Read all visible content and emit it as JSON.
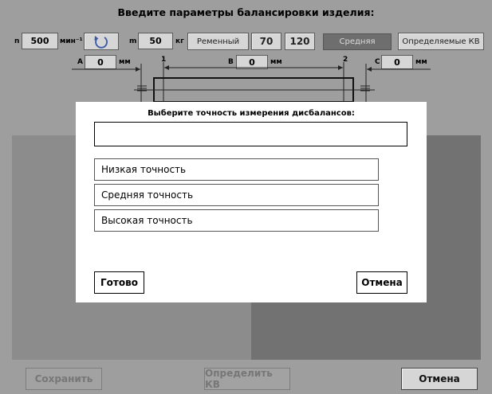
{
  "header": {
    "title": "Введите параметры балансировки изделия:"
  },
  "params": {
    "n_label": "n",
    "n_value": "500",
    "n_unit": "мин⁻¹",
    "rotate_icon": "rotate-ccw-icon",
    "m_label": "m",
    "m_value": "50",
    "m_unit": "кг",
    "drive_type": "Ременный",
    "value_70": "70",
    "value_120": "120",
    "accuracy_current": "Средняя",
    "define_kv": "Определяемые КВ"
  },
  "dimensions": {
    "a_label": "A",
    "a_value": "0",
    "a_unit": "мм",
    "b_label": "B",
    "b_value": "0",
    "b_unit": "мм",
    "c_label": "C",
    "c_value": "0",
    "c_unit": "мм",
    "plane1": "1",
    "plane2": "2"
  },
  "dialog": {
    "title": "Выберите точность измерения дисбалансов:",
    "input_value": "",
    "options": [
      {
        "label": "Низкая точность"
      },
      {
        "label": "Средняя точность"
      },
      {
        "label": "Высокая точность"
      }
    ],
    "ok": "Готово",
    "cancel": "Отмена"
  },
  "footer": {
    "save": "Сохранить",
    "define": "Определить КВ",
    "cancel": "Отмена"
  },
  "colors": {
    "background": "#9e9e9e",
    "button": "#d6d6d6",
    "selected_button": "#6e6e6e",
    "dialog": "#ffffff"
  }
}
